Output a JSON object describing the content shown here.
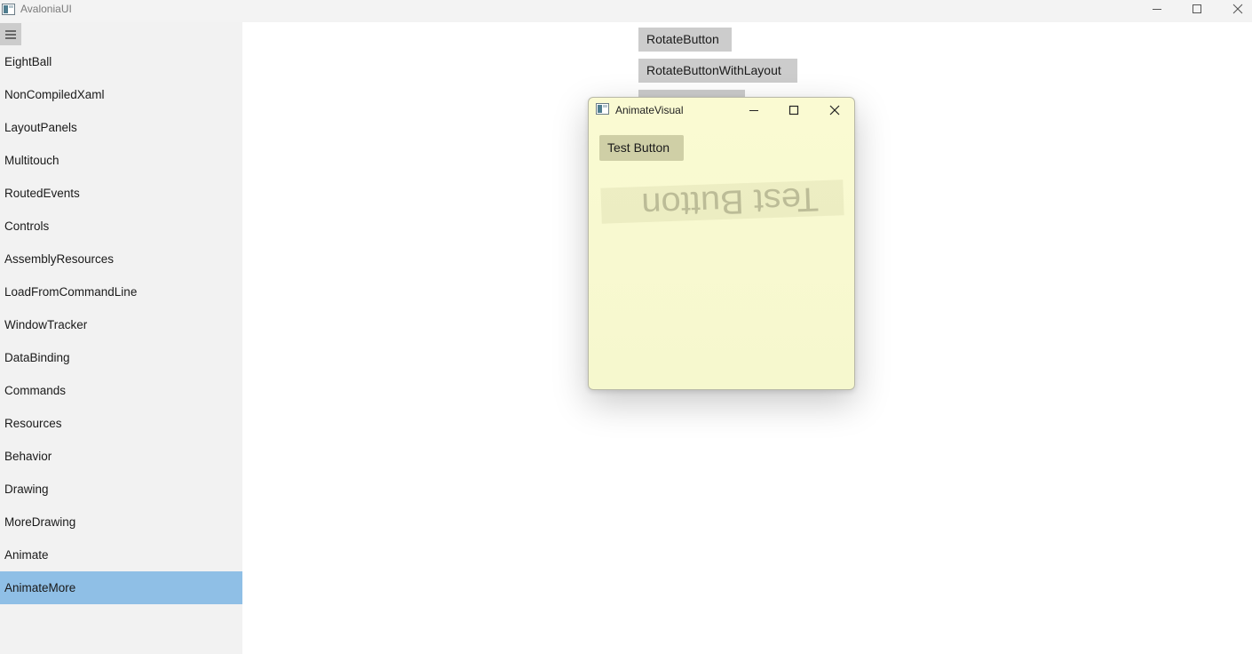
{
  "window": {
    "title": "AvaloniaUI"
  },
  "sidebar": {
    "menu_icon": "hamburger-menu-icon",
    "items": [
      {
        "label": "EightBall"
      },
      {
        "label": "NonCompiledXaml"
      },
      {
        "label": "LayoutPanels"
      },
      {
        "label": "Multitouch"
      },
      {
        "label": "RoutedEvents"
      },
      {
        "label": "Controls"
      },
      {
        "label": "AssemblyResources"
      },
      {
        "label": "LoadFromCommandLine"
      },
      {
        "label": "WindowTracker"
      },
      {
        "label": "DataBinding"
      },
      {
        "label": "Commands"
      },
      {
        "label": "Resources"
      },
      {
        "label": "Behavior"
      },
      {
        "label": "Drawing"
      },
      {
        "label": "MoreDrawing"
      },
      {
        "label": "Animate"
      },
      {
        "label": "AnimateMore"
      }
    ],
    "selected": "AnimateMore",
    "selected_color": "#8fbfe6"
  },
  "content": {
    "buttons": {
      "rotate": "RotateButton",
      "rotate_with_layout": "RotateButtonWithLayout"
    }
  },
  "child_window": {
    "title": "AnimateVisual",
    "test_button": "Test Button",
    "rotated_text": "Test Button",
    "background": "#fafad2"
  }
}
